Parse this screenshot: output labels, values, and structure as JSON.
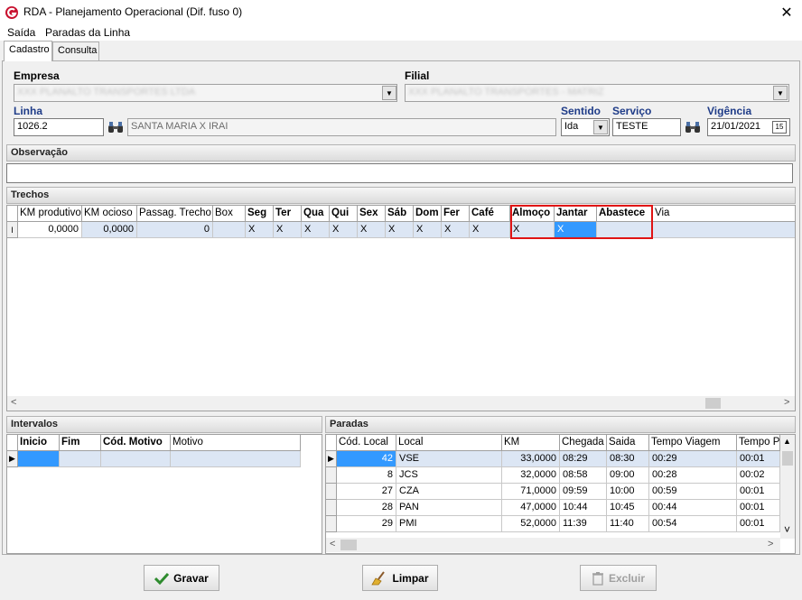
{
  "window": {
    "title": "RDA - Planejamento Operacional (Dif. fuso 0)",
    "close": "✕"
  },
  "menu": [
    "Saída",
    "Paradas da Linha"
  ],
  "tabs": [
    "Cadastro",
    "Consulta"
  ],
  "form": {
    "empresa_label": "Empresa",
    "empresa_value": "XXX PLANALTO TRANSPORTES LTDA",
    "filial_label": "Filial",
    "filial_value": "XXX PLANALTO TRANSPORTES - MATRIZ",
    "linha_label": "Linha",
    "linha_code": "1026.2",
    "linha_name": "SANTA MARIA X IRAI",
    "sentido_label": "Sentido",
    "sentido_value": "Ida",
    "servico_label": "Serviço",
    "servico_value": "TESTE",
    "vigencia_label": "Vigência",
    "vigencia_value": "21/01/2021",
    "observacao_label": "Observação",
    "observacao_value": ""
  },
  "trechos": {
    "title": "Trechos",
    "columns": [
      "KM produtivo",
      "KM ocioso",
      "Passag. Trecho",
      "Box",
      "Seg",
      "Ter",
      "Qua",
      "Qui",
      "Sex",
      "Sáb",
      "Dom",
      "Fer",
      "Café",
      "Almoço",
      "Jantar",
      "Abastece",
      "Via"
    ],
    "row": [
      "0,0000",
      "0,0000",
      "0",
      "",
      "X",
      "X",
      "X",
      "X",
      "X",
      "X",
      "X",
      "X",
      "X",
      "X",
      "X",
      "",
      ""
    ],
    "row_indicator": "I"
  },
  "intervalos": {
    "title": "Intervalos",
    "columns": [
      "Inicio",
      "Fim",
      "Cód. Motivo",
      "Motivo"
    ]
  },
  "paradas": {
    "title": "Paradas",
    "columns": [
      "Cód. Local",
      "Local",
      "KM",
      "Chegada",
      "Saida",
      "Tempo Viagem",
      "Tempo P"
    ],
    "rows": [
      [
        "42",
        "VSE",
        "33,0000",
        "08:29",
        "08:30",
        "00:29",
        "00:01"
      ],
      [
        "8",
        "JCS",
        "32,0000",
        "08:58",
        "09:00",
        "00:28",
        "00:02"
      ],
      [
        "27",
        "CZA",
        "71,0000",
        "09:59",
        "10:00",
        "00:59",
        "00:01"
      ],
      [
        "28",
        "PAN",
        "47,0000",
        "10:44",
        "10:45",
        "00:44",
        "00:01"
      ],
      [
        "29",
        "PMI",
        "52,0000",
        "11:39",
        "11:40",
        "00:54",
        "00:01"
      ]
    ]
  },
  "buttons": {
    "gravar": "Gravar",
    "limpar": "Limpar",
    "excluir": "Excluir"
  },
  "colors": {
    "selection": "#3399ff",
    "row_highlight": "#dce6f4",
    "label_blue": "#1f3c88",
    "highlight_box": "#e01414"
  }
}
